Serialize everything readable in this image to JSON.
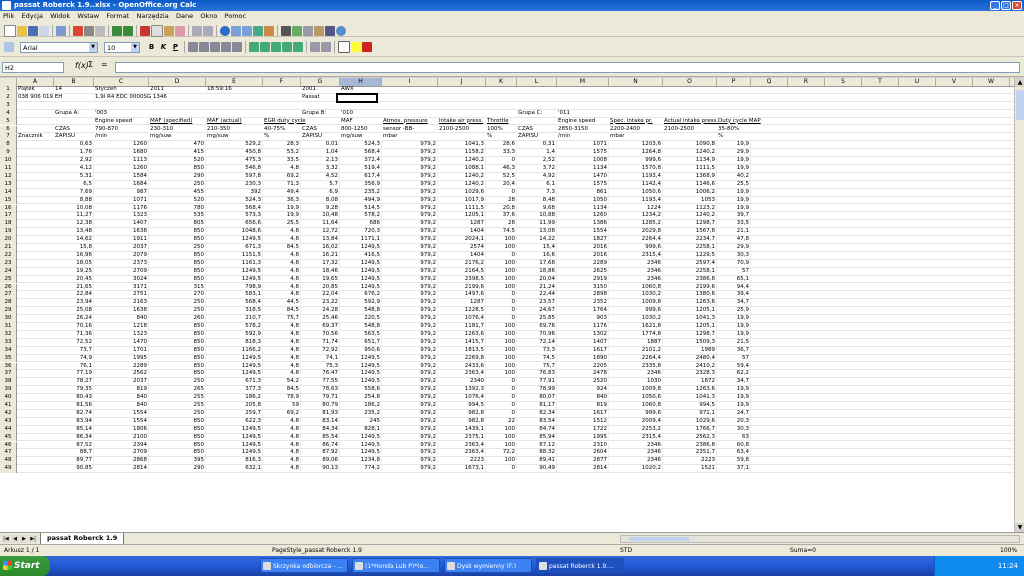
{
  "window": {
    "title": "passat Roberck 1.9..xlsx - OpenOffice.org Calc"
  },
  "menubar": [
    "Plik",
    "Edycja",
    "Widok",
    "Wstaw",
    "Format",
    "Narzędzia",
    "Dane",
    "Okno",
    "Pomoc"
  ],
  "toolbar": {
    "font_name": "Arial",
    "font_size": "10"
  },
  "formula": {
    "cell_ref": "H2",
    "content": ""
  },
  "columns": [
    "A",
    "B",
    "C",
    "D",
    "E",
    "F",
    "G",
    "H",
    "I",
    "J",
    "K",
    "L",
    "M",
    "N",
    "O",
    "P",
    "Q",
    "R",
    "S",
    "T",
    "U",
    "V",
    "W"
  ],
  "selected_column": "H",
  "grid_rows": [
    {
      "n": "1",
      "cells": {
        "A": "Piątek",
        "B": "14",
        "C": "Styczeń",
        "D": "2011",
        "E": "18:59:16",
        "G": "2001",
        "H": "AWX"
      }
    },
    {
      "n": "2",
      "cells": {
        "A": "038 906 019 EH",
        "C": "1,9l R4 EDC 0000SG 1346",
        "G": "Passat"
      }
    },
    {
      "n": "3",
      "cells": {}
    },
    {
      "n": "4",
      "cells": {
        "B": "Grupa A:",
        "C": "'003",
        "G": "Grupa B:",
        "H": "'010",
        "L": "Grupa C:",
        "M": "'011"
      }
    },
    {
      "n": "5",
      "cells": {
        "C": "Engine speed",
        "D": "MAF (specified)",
        "E": "MAF (actual)",
        "F": "EGR duty cycle",
        "H": "MAF",
        "I": "Atmos. pressure",
        "J": "Intake air press.",
        "K": "Throttle",
        "M": "Engine speed",
        "N": "Spec. intake pr.",
        "O": "Actual intake press.",
        "P": "Duty cycle MAP"
      }
    },
    {
      "n": "6",
      "cells": {
        "B": "CZAS",
        "C": "790-870",
        "D": "230-310",
        "E": "210-350",
        "F": "40-75%",
        "G": "CZAS",
        "H": "800-1250",
        "I": "sensor -BB-",
        "J": "2100-2500",
        "K": "100%",
        "L": "CZAS",
        "M": "2850-3150",
        "N": "2200-2400",
        "O": "2100-2500",
        "P": "35-80%"
      }
    },
    {
      "n": "7",
      "cells": {
        "A": "Znacznik",
        "B": "ZAPISU",
        "C": "/min",
        "D": "mg/suw",
        "E": "mg/suw",
        "F": "%",
        "G": "ZAPISU",
        "H": "mg/suw",
        "I": "mbar",
        "K": "%",
        "L": "ZAPISU",
        "M": "/min",
        "N": "mbar",
        "P": "%"
      }
    },
    {
      "n": "8",
      "cells": {
        "B": "0,63",
        "C": "1260",
        "D": "470",
        "E": "529,2",
        "F": "28,3",
        "G": "0,01",
        "H": "524,3",
        "I": "979,2",
        "J": "1041,3",
        "K": "28,6",
        "L": "0,31",
        "M": "1071",
        "N": "1203,6",
        "O": "1090,8",
        "P": "19,9"
      }
    },
    {
      "n": "9",
      "cells": {
        "B": "1,76",
        "C": "1680",
        "D": "415",
        "E": "450,8",
        "F": "53,2",
        "G": "1,04",
        "H": "568,4",
        "I": "979,2",
        "J": "1158,2",
        "K": "33,3",
        "L": "1,4",
        "M": "1575",
        "N": "1264,8",
        "O": "1240,2",
        "P": "29,9"
      }
    },
    {
      "n": "10",
      "cells": {
        "B": "2,92",
        "C": "1113",
        "D": "520",
        "E": "475,3",
        "F": "33,5",
        "G": "2,13",
        "H": "372,4",
        "I": "979,2",
        "J": "1240,2",
        "K": "0",
        "L": "2,52",
        "M": "1008",
        "N": "999,6",
        "O": "1134,9",
        "P": "19,9"
      }
    },
    {
      "n": "11",
      "cells": {
        "B": "4,12",
        "C": "1260",
        "D": "850",
        "E": "546,8",
        "F": "4,8",
        "G": "3,32",
        "H": "519,4",
        "I": "979,2",
        "J": "1088,1",
        "K": "46,3",
        "L": "3,72",
        "M": "1134",
        "N": "1570,8",
        "O": "1111,5",
        "P": "19,9"
      }
    },
    {
      "n": "12",
      "cells": {
        "B": "5,31",
        "C": "1584",
        "D": "290",
        "E": "597,8",
        "F": "69,2",
        "G": "4,52",
        "H": "617,4",
        "I": "979,2",
        "J": "1240,2",
        "K": "52,5",
        "L": "4,92",
        "M": "1470",
        "N": "1193,4",
        "O": "1368,9",
        "P": "40,2"
      }
    },
    {
      "n": "13",
      "cells": {
        "B": "6,5",
        "C": "1684",
        "D": "250",
        "E": "230,3",
        "F": "71,3",
        "G": "5,7",
        "H": "356,9",
        "I": "979,2",
        "J": "1240,2",
        "K": "20,4",
        "L": "6,1",
        "M": "1575",
        "N": "1142,4",
        "O": "1146,6",
        "P": "25,5"
      }
    },
    {
      "n": "14",
      "cells": {
        "B": "7,69",
        "C": "987",
        "D": "455",
        "E": "392",
        "F": "49,4",
        "G": "6,9",
        "H": "235,2",
        "I": "979,2",
        "J": "1029,6",
        "K": "0",
        "L": "7,3",
        "M": "861",
        "N": "1050,6",
        "O": "1006,2",
        "P": "19,9"
      }
    },
    {
      "n": "15",
      "cells": {
        "B": "8,88",
        "C": "1071",
        "D": "520",
        "E": "524,3",
        "F": "36,3",
        "G": "8,08",
        "H": "494,9",
        "I": "979,2",
        "J": "1017,9",
        "K": "28",
        "L": "8,48",
        "M": "1050",
        "N": "1193,4",
        "O": "1053",
        "P": "19,9"
      }
    },
    {
      "n": "16",
      "cells": {
        "B": "10,08",
        "C": "1176",
        "D": "780",
        "E": "568,4",
        "F": "19,9",
        "G": "9,28",
        "H": "514,5",
        "I": "979,2",
        "J": "1111,5",
        "K": "20,8",
        "L": "9,68",
        "M": "1134",
        "N": "1224",
        "O": "1123,2",
        "P": "19,9"
      }
    },
    {
      "n": "17",
      "cells": {
        "B": "11,27",
        "C": "1323",
        "D": "535",
        "E": "573,3",
        "F": "19,9",
        "G": "10,48",
        "H": "578,2",
        "I": "979,2",
        "J": "1205,1",
        "K": "37,6",
        "L": "10,88",
        "M": "1260",
        "N": "1234,2",
        "O": "1240,2",
        "P": "39,7"
      }
    },
    {
      "n": "18",
      "cells": {
        "B": "12,38",
        "C": "1407",
        "D": "805",
        "E": "656,6",
        "F": "25,5",
        "G": "11,64",
        "H": "686",
        "I": "979,2",
        "J": "1287",
        "K": "28",
        "L": "11,99",
        "M": "1386",
        "N": "1285,2",
        "O": "1298,7",
        "P": "33,5"
      }
    },
    {
      "n": "19",
      "cells": {
        "B": "13,48",
        "C": "1638",
        "D": "850",
        "E": "1048,6",
        "F": "4,8",
        "G": "12,72",
        "H": "720,3",
        "I": "979,2",
        "J": "1404",
        "K": "74,5",
        "L": "13,08",
        "M": "1554",
        "N": "2029,8",
        "O": "1567,8",
        "P": "21,1"
      }
    },
    {
      "n": "20",
      "cells": {
        "B": "14,62",
        "C": "1911",
        "D": "850",
        "E": "1249,5",
        "F": "4,8",
        "G": "13,84",
        "H": "1171,1",
        "I": "979,2",
        "J": "2024,1",
        "K": "100",
        "L": "14,22",
        "M": "1827",
        "N": "2264,4",
        "O": "2234,7",
        "P": "47,8"
      }
    },
    {
      "n": "21",
      "cells": {
        "B": "15,8",
        "C": "2037",
        "D": "250",
        "E": "671,3",
        "F": "84,5",
        "G": "16,02",
        "H": "1249,5",
        "I": "979,2",
        "J": "2574",
        "K": "100",
        "L": "15,4",
        "M": "2016",
        "N": "999,6",
        "O": "2258,1",
        "P": "29,9"
      }
    },
    {
      "n": "22",
      "cells": {
        "B": "16,96",
        "C": "2079",
        "D": "850",
        "E": "1151,5",
        "F": "4,8",
        "G": "16,21",
        "H": "416,5",
        "I": "979,2",
        "J": "1404",
        "K": "0",
        "L": "16,6",
        "M": "2016",
        "N": "2315,4",
        "O": "1229,5",
        "P": "30,3"
      }
    },
    {
      "n": "23",
      "cells": {
        "B": "18,05",
        "C": "2373",
        "D": "850",
        "E": "1161,3",
        "F": "4,8",
        "G": "17,32",
        "H": "1249,5",
        "I": "979,2",
        "J": "2176,2",
        "K": "100",
        "L": "17,68",
        "M": "2289",
        "N": "2346",
        "O": "2597,4",
        "P": "70,9"
      }
    },
    {
      "n": "24",
      "cells": {
        "B": "19,25",
        "C": "2709",
        "D": "850",
        "E": "1249,5",
        "F": "4,8",
        "G": "18,46",
        "H": "1249,5",
        "I": "979,2",
        "J": "2164,5",
        "K": "100",
        "L": "18,86",
        "M": "2625",
        "N": "2346",
        "O": "2258,1",
        "P": "57"
      }
    },
    {
      "n": "25",
      "cells": {
        "B": "20,45",
        "C": "3024",
        "D": "850",
        "E": "1249,5",
        "F": "4,8",
        "G": "19,65",
        "H": "1249,5",
        "I": "979,2",
        "J": "2398,5",
        "K": "100",
        "L": "20,04",
        "M": "2919",
        "N": "2346",
        "O": "2386,8",
        "P": "65,1"
      }
    },
    {
      "n": "26",
      "cells": {
        "B": "21,65",
        "C": "3171",
        "D": "315",
        "E": "798,9",
        "F": "4,8",
        "G": "20,85",
        "H": "1249,5",
        "I": "979,2",
        "J": "2199,6",
        "K": "100",
        "L": "21,24",
        "M": "3150",
        "N": "1060,8",
        "O": "2199,6",
        "P": "94,4"
      }
    },
    {
      "n": "27",
      "cells": {
        "B": "22,84",
        "C": "2751",
        "D": "270",
        "E": "583,1",
        "F": "4,8",
        "G": "22,04",
        "H": "676,2",
        "I": "979,2",
        "J": "1497,6",
        "K": "0",
        "L": "22,44",
        "M": "2898",
        "N": "1030,2",
        "O": "1380,6",
        "P": "39,4"
      }
    },
    {
      "n": "28",
      "cells": {
        "B": "23,94",
        "C": "2163",
        "D": "250",
        "E": "568,4",
        "F": "44,5",
        "G": "23,22",
        "H": "592,9",
        "I": "979,2",
        "J": "1287",
        "K": "0",
        "L": "23,57",
        "M": "2352",
        "N": "1009,8",
        "O": "1263,6",
        "P": "34,7"
      }
    },
    {
      "n": "29",
      "cells": {
        "B": "25,08",
        "C": "1638",
        "D": "250",
        "E": "318,5",
        "F": "84,5",
        "G": "24,28",
        "H": "548,8",
        "I": "979,2",
        "J": "1228,5",
        "K": "0",
        "L": "24,67",
        "M": "1764",
        "N": "999,6",
        "O": "1205,1",
        "P": "25,9"
      }
    },
    {
      "n": "30",
      "cells": {
        "B": "26,24",
        "C": "840",
        "D": "260",
        "E": "210,7",
        "F": "75,7",
        "G": "25,46",
        "H": "220,5",
        "I": "979,2",
        "J": "1076,4",
        "K": "0",
        "L": "25,85",
        "M": "903",
        "N": "1030,2",
        "O": "1041,3",
        "P": "19,9"
      }
    },
    {
      "n": "31",
      "cells": {
        "B": "70,16",
        "C": "1218",
        "D": "850",
        "E": "578,2",
        "F": "4,8",
        "G": "69,37",
        "H": "548,8",
        "I": "979,2",
        "J": "1181,7",
        "K": "100",
        "L": "69,76",
        "M": "1176",
        "N": "1621,8",
        "O": "1205,1",
        "P": "19,9"
      }
    },
    {
      "n": "32",
      "cells": {
        "B": "71,36",
        "C": "1323",
        "D": "850",
        "E": "592,9",
        "F": "4,8",
        "G": "70,56",
        "H": "563,5",
        "I": "979,2",
        "J": "1263,6",
        "K": "100",
        "L": "70,96",
        "M": "1302",
        "N": "1774,8",
        "O": "1298,7",
        "P": "19,9"
      }
    },
    {
      "n": "33",
      "cells": {
        "B": "72,52",
        "C": "1470",
        "D": "850",
        "E": "818,3",
        "F": "4,8",
        "G": "71,74",
        "H": "651,7",
        "I": "979,2",
        "J": "1415,7",
        "K": "100",
        "L": "72,14",
        "M": "1407",
        "N": "1887",
        "O": "1509,3",
        "P": "21,5"
      }
    },
    {
      "n": "34",
      "cells": {
        "B": "73,7",
        "C": "1701",
        "D": "850",
        "E": "1166,2",
        "F": "4,8",
        "G": "72,92",
        "H": "950,6",
        "I": "979,2",
        "J": "1813,5",
        "K": "100",
        "L": "73,3",
        "M": "1617",
        "N": "2101,2",
        "O": "1989",
        "P": "36,7"
      }
    },
    {
      "n": "35",
      "cells": {
        "B": "74,9",
        "C": "1995",
        "D": "850",
        "E": "1249,5",
        "F": "4,8",
        "G": "74,1",
        "H": "1249,5",
        "I": "979,2",
        "J": "2269,8",
        "K": "100",
        "L": "74,5",
        "M": "1890",
        "N": "2264,4",
        "O": "2480,4",
        "P": "57"
      }
    },
    {
      "n": "36",
      "cells": {
        "B": "76,1",
        "C": "2289",
        "D": "850",
        "E": "1249,5",
        "F": "4,8",
        "G": "75,3",
        "H": "1249,5",
        "I": "979,2",
        "J": "2433,6",
        "K": "100",
        "L": "75,7",
        "M": "2205",
        "N": "2335,8",
        "O": "2410,2",
        "P": "59,4"
      }
    },
    {
      "n": "37",
      "cells": {
        "B": "77,19",
        "C": "2562",
        "D": "850",
        "E": "1249,5",
        "F": "4,8",
        "G": "76,47",
        "H": "1249,5",
        "I": "979,2",
        "J": "2363,4",
        "K": "100",
        "L": "76,83",
        "M": "2478",
        "N": "2346",
        "O": "2328,3",
        "P": "62,2"
      }
    },
    {
      "n": "38",
      "cells": {
        "B": "78,27",
        "C": "2037",
        "D": "250",
        "E": "671,3",
        "F": "54,2",
        "G": "77,55",
        "H": "1249,5",
        "I": "979,2",
        "J": "2340",
        "K": "0",
        "L": "77,91",
        "M": "2520",
        "N": "1030",
        "O": "1872",
        "P": "34,7"
      }
    },
    {
      "n": "39",
      "cells": {
        "B": "79,35",
        "C": "819",
        "D": "265",
        "E": "377,3",
        "F": "84,5",
        "G": "78,63",
        "H": "558,6",
        "I": "979,2",
        "J": "1392,3",
        "K": "0",
        "L": "78,99",
        "M": "924",
        "N": "1009,8",
        "O": "1263,6",
        "P": "19,9"
      }
    },
    {
      "n": "40",
      "cells": {
        "B": "80,43",
        "C": "840",
        "D": "255",
        "E": "186,2",
        "F": "78,9",
        "G": "79,71",
        "H": "254,8",
        "I": "979,2",
        "J": "1076,4",
        "K": "0",
        "L": "80,07",
        "M": "840",
        "N": "1050,6",
        "O": "1041,3",
        "P": "19,9"
      }
    },
    {
      "n": "41",
      "cells": {
        "B": "81,56",
        "C": "840",
        "D": "255",
        "E": "205,8",
        "F": "59",
        "G": "80,79",
        "H": "186,2",
        "I": "979,2",
        "J": "994,5",
        "K": "0",
        "L": "81,17",
        "M": "819",
        "N": "1060,8",
        "O": "994,5",
        "P": "19,9"
      }
    },
    {
      "n": "42",
      "cells": {
        "B": "82,74",
        "C": "1554",
        "D": "250",
        "E": "259,7",
        "F": "69,2",
        "G": "81,93",
        "H": "235,2",
        "I": "979,2",
        "J": "982,8",
        "K": "0",
        "L": "82,34",
        "M": "1617",
        "N": "999,6",
        "O": "971,1",
        "P": "24,7"
      }
    },
    {
      "n": "43",
      "cells": {
        "B": "83,94",
        "C": "1554",
        "D": "850",
        "E": "622,3",
        "F": "4,8",
        "G": "83,14",
        "H": "245",
        "I": "979,2",
        "J": "982,8",
        "K": "22",
        "L": "83,54",
        "M": "1512",
        "N": "2009,4",
        "O": "1029,6",
        "P": "20,3"
      }
    },
    {
      "n": "44",
      "cells": {
        "B": "85,14",
        "C": "1806",
        "D": "850",
        "E": "1249,5",
        "F": "4,8",
        "G": "84,34",
        "H": "828,1",
        "I": "979,2",
        "J": "1439,1",
        "K": "100",
        "L": "84,74",
        "M": "1722",
        "N": "2253,2",
        "O": "1766,7",
        "P": "30,3"
      }
    },
    {
      "n": "45",
      "cells": {
        "B": "86,34",
        "C": "2100",
        "D": "850",
        "E": "1249,5",
        "F": "4,8",
        "G": "85,54",
        "H": "1249,5",
        "I": "979,2",
        "J": "2375,1",
        "K": "100",
        "L": "85,94",
        "M": "1995",
        "N": "2315,4",
        "O": "2562,3",
        "P": "63"
      }
    },
    {
      "n": "46",
      "cells": {
        "B": "87,52",
        "C": "2394",
        "D": "850",
        "E": "1249,5",
        "F": "4,8",
        "G": "86,74",
        "H": "1249,5",
        "I": "979,2",
        "J": "2363,4",
        "K": "100",
        "L": "87,12",
        "M": "2310",
        "N": "2346",
        "O": "2386,8",
        "P": "60,8"
      }
    },
    {
      "n": "47",
      "cells": {
        "B": "88,7",
        "C": "2709",
        "D": "850",
        "E": "1249,5",
        "F": "4,8",
        "G": "87,92",
        "H": "1249,5",
        "I": "979,2",
        "J": "2363,4",
        "K": "72,2",
        "L": "88,32",
        "M": "2604",
        "N": "2346",
        "O": "2351,7",
        "P": "63,4"
      }
    },
    {
      "n": "48",
      "cells": {
        "B": "89,77",
        "C": "2868",
        "D": "395",
        "E": "816,3",
        "F": "4,8",
        "G": "89,06",
        "H": "1234,8",
        "I": "979,2",
        "J": "2223",
        "K": "100",
        "L": "89,41",
        "M": "2877",
        "N": "2346",
        "O": "2223",
        "P": "59,8"
      }
    },
    {
      "n": "49",
      "cells": {
        "B": "90,85",
        "C": "2814",
        "D": "290",
        "E": "632,1",
        "F": "4,8",
        "G": "90,13",
        "H": "774,2",
        "I": "979,2",
        "J": "1673,1",
        "K": "0",
        "L": "90,49",
        "M": "2814",
        "N": "1020,2",
        "O": "1521",
        "P": "37,1"
      }
    }
  ],
  "sheet_tab": "passat Roberck 1.9",
  "status": {
    "sheet": "Arkusz 1 / 1",
    "page_style": "PageStyle_passat Roberck 1.9",
    "mode": "STD",
    "sum": "Suma=0",
    "zoom": "100%"
  },
  "taskbar": {
    "start": "Start",
    "tasks": [
      "Skrzynka odbiorcza - ...",
      "(1*Honda Lub P)*(o...",
      "Dysk wymienny (F:)",
      "passat Roberck 1.9...."
    ],
    "clock": "11:24"
  }
}
